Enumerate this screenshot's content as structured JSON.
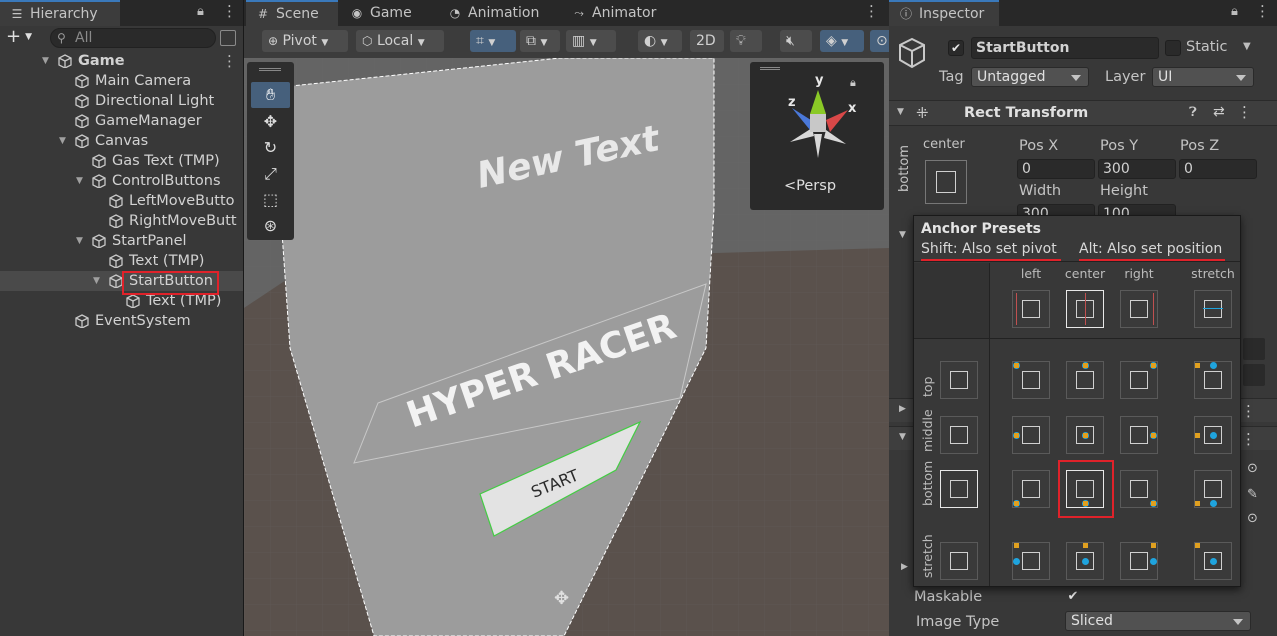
{
  "hierarchy": {
    "tab_label": "Hierarchy",
    "add_label": "+",
    "search_placeholder": "All",
    "items": [
      {
        "label": "Game",
        "depth": 0,
        "arrow": "down",
        "scene": true
      },
      {
        "label": "Main Camera",
        "depth": 1
      },
      {
        "label": "Directional Light",
        "depth": 1
      },
      {
        "label": "GameManager",
        "depth": 1
      },
      {
        "label": "Canvas",
        "depth": 1,
        "arrow": "down"
      },
      {
        "label": "Gas Text (TMP)",
        "depth": 2
      },
      {
        "label": "ControlButtons",
        "depth": 2,
        "arrow": "down"
      },
      {
        "label": "LeftMoveButto",
        "depth": 3
      },
      {
        "label": "RightMoveButt",
        "depth": 3
      },
      {
        "label": "StartPanel",
        "depth": 2,
        "arrow": "down"
      },
      {
        "label": "Text (TMP)",
        "depth": 3
      },
      {
        "label": "StartButton",
        "depth": 3,
        "arrow": "down",
        "selected": true
      },
      {
        "label": "Text (TMP)",
        "depth": 4
      },
      {
        "label": "EventSystem",
        "depth": 1
      }
    ]
  },
  "scene_tabs": [
    {
      "label": "Scene",
      "icon": "grid-icon"
    },
    {
      "label": "Game",
      "icon": "gamepad-icon"
    },
    {
      "label": "Animation",
      "icon": "clock-icon"
    },
    {
      "label": "Animator",
      "icon": "animator-icon"
    }
  ],
  "scene_toolbar": {
    "pivot": "Pivot",
    "local": "Local",
    "mode_2d": "2D"
  },
  "scene_view": {
    "text_new": "New Text",
    "text_title": "HYPER RACER",
    "text_start": "START",
    "persp": "Persp",
    "gizmo_y": "y",
    "gizmo_x": "x",
    "gizmo_z": "z"
  },
  "inspector": {
    "tab_label": "Inspector",
    "object_name": "StartButton",
    "static_label": "Static",
    "tag_label": "Tag",
    "tag_value": "Untagged",
    "layer_label": "Layer",
    "layer_value": "UI",
    "rect_transform_title": "Rect Transform",
    "anchor_h": "center",
    "anchor_v": "bottom",
    "pos_x_label": "Pos X",
    "pos_y_label": "Pos Y",
    "pos_z_label": "Pos Z",
    "pos_x": "0",
    "pos_y": "300",
    "pos_z": "0",
    "width_label": "Width",
    "height_label": "Height",
    "width": "300",
    "height": "100",
    "maskable_label": "Maskable",
    "image_type_label": "Image Type",
    "image_type_value": "Sliced"
  },
  "anchor_presets": {
    "title": "Anchor Presets",
    "shift_hint": "Shift: Also set pivot",
    "alt_hint": "Alt: Also set position",
    "columns": [
      "left",
      "center",
      "right",
      "stretch"
    ],
    "rows": [
      "top",
      "middle",
      "bottom",
      "stretch"
    ],
    "selected": "bottom-center"
  },
  "colors": {
    "accent": "#3a79bb",
    "highlight_red": "#e0222a",
    "pivot_blue": "#1fa4de",
    "anchor_orange": "#e0a020"
  }
}
